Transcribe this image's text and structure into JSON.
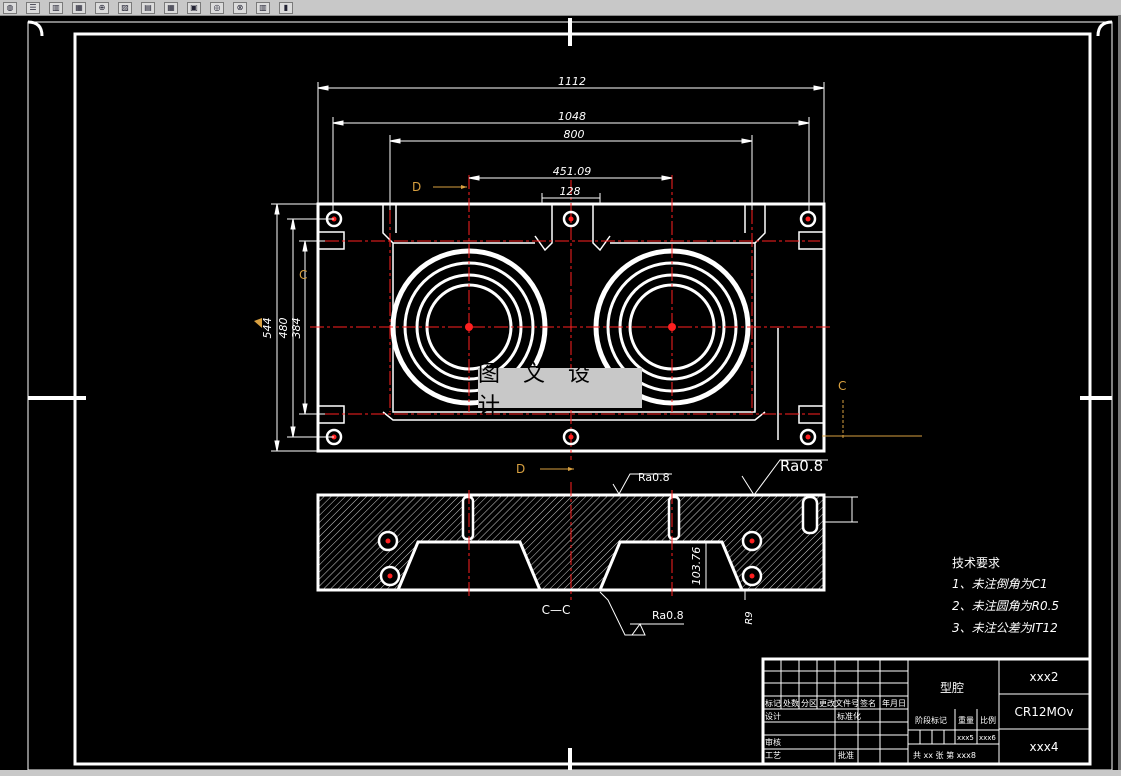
{
  "toolbar": {
    "icons": [
      "draw-icon",
      "layer-icon",
      "bar-icon",
      "panel-icon",
      "insert-icon",
      "hatch-icon",
      "table-icon",
      "grid-icon",
      "block-icon",
      "snap-icon",
      "orbit-icon",
      "column-icon",
      "properties-icon"
    ]
  },
  "dims": {
    "d1112": "1112",
    "d1048": "1048",
    "d800": "800",
    "d451": "451.09",
    "d128": "128",
    "d544": "544",
    "d480": "480",
    "d384": "384",
    "d10376": "103.76",
    "r9": "R9"
  },
  "labels": {
    "sectionD": "D",
    "sectionC": "C",
    "sectionCC": "C—C",
    "ra1": "Ra0.8",
    "ra2": "Ra0.8",
    "ra3": "Ra0.8",
    "watermark": "图 文 设 计"
  },
  "tech": {
    "title": "技术要求",
    "item1": "1、未注倒角为C1",
    "item2": "2、未注圆角为R0.5",
    "item3": "3、未注公差为IT12"
  },
  "titleblock": {
    "part_name": "型腔",
    "code": "xxx2",
    "material": "CR12MOv",
    "company": "xxx4",
    "c1": "标记",
    "c2": "处数",
    "c3": "分区",
    "c4": "更改文件号",
    "c5": "签名",
    "c6": "年月日",
    "design": "设计",
    "standard": "标准化",
    "check": "审核",
    "process": "工艺",
    "approve": "批准",
    "stage": "阶段标记",
    "weight": "重量",
    "scale": "比例",
    "weight_val": "xxx5",
    "scale_val": "xxx6",
    "sheets": "共 xx 张  第 xxx8"
  },
  "colors": {
    "bg": "#000000",
    "line": "#ffffff",
    "center": "#ff0000",
    "dim": "#ffffff",
    "section": "#d8a040"
  }
}
